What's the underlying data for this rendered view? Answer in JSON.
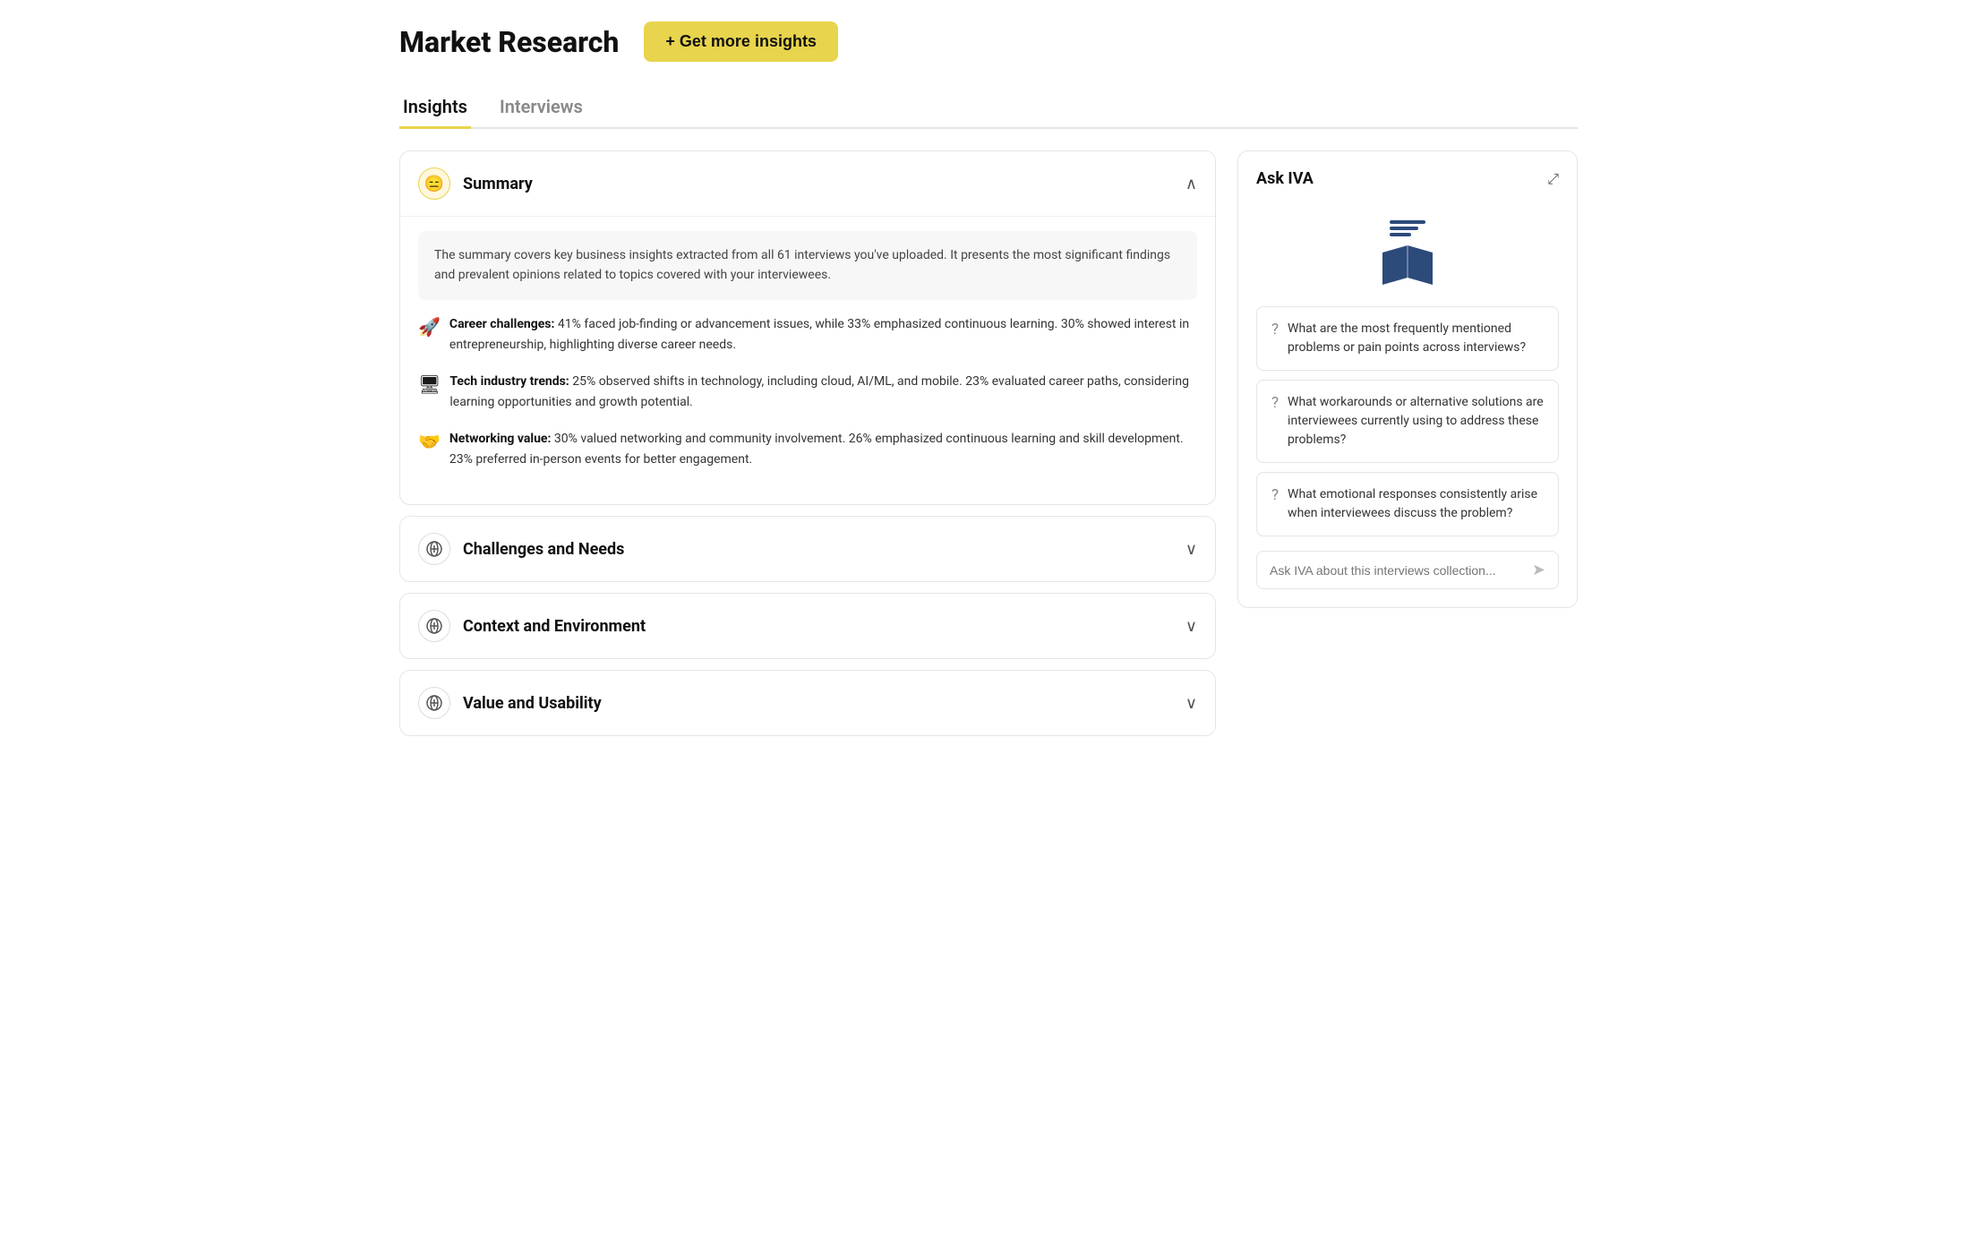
{
  "header": {
    "title": "Market Research",
    "get_insights_label": "+ Get more insights"
  },
  "tabs": [
    {
      "id": "insights",
      "label": "Insights",
      "active": true
    },
    {
      "id": "interviews",
      "label": "Interviews",
      "active": false
    }
  ],
  "summary_section": {
    "title": "Summary",
    "intro": "The summary covers key business insights extracted from all 61 interviews you've uploaded. It presents the most significant findings and prevalent opinions related to topics covered with your interviewees.",
    "insights": [
      {
        "emoji": "🚀",
        "label": "Career challenges:",
        "text": "41% faced job-finding or advancement issues, while 33% emphasized continuous learning. 30% showed interest in entrepreneurship, highlighting diverse career needs."
      },
      {
        "emoji": "🖥",
        "label": "Tech industry trends:",
        "text": "25% observed shifts in technology, including cloud, AI/ML, and mobile. 23% evaluated career paths, considering learning opportunities and growth potential."
      },
      {
        "emoji": "🤝",
        "label": "Networking value:",
        "text": "30% valued networking and community involvement. 26% emphasized continuous learning and skill development. 23% preferred in-person events for better engagement."
      }
    ]
  },
  "accordion_sections": [
    {
      "id": "challenges",
      "title": "Challenges and Needs",
      "open": false
    },
    {
      "id": "context",
      "title": "Context and Environment",
      "open": false
    },
    {
      "id": "value",
      "title": "Value and Usability",
      "open": false
    }
  ],
  "ask_iva": {
    "title": "Ask IVA",
    "questions": [
      "What are the most frequently mentioned problems or pain points across interviews?",
      "What workarounds or alternative solutions are interviewees currently using to address these problems?",
      "What emotional responses consistently arise when interviewees discuss the problem?"
    ],
    "input_placeholder": "Ask IVA about this interviews collection..."
  }
}
